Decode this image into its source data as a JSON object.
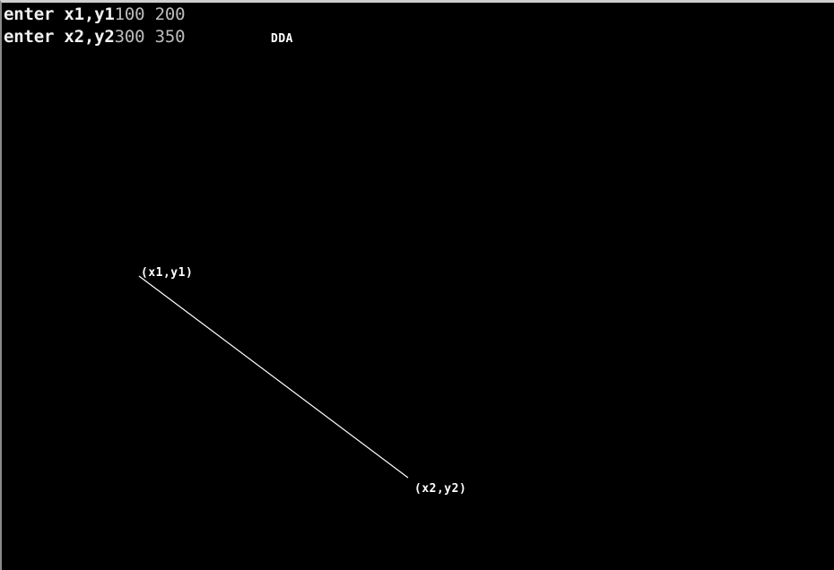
{
  "console": {
    "line1": {
      "prompt": "enter x1,y1",
      "input": "100 200"
    },
    "line2": {
      "prompt": "enter x2,y2",
      "input": "300 350"
    }
  },
  "graphics": {
    "title": "DDA",
    "start_label": "(x1,y1)",
    "end_label": "(x2,y2)",
    "line_color": "#ffffff",
    "background_color": "#000000"
  }
}
